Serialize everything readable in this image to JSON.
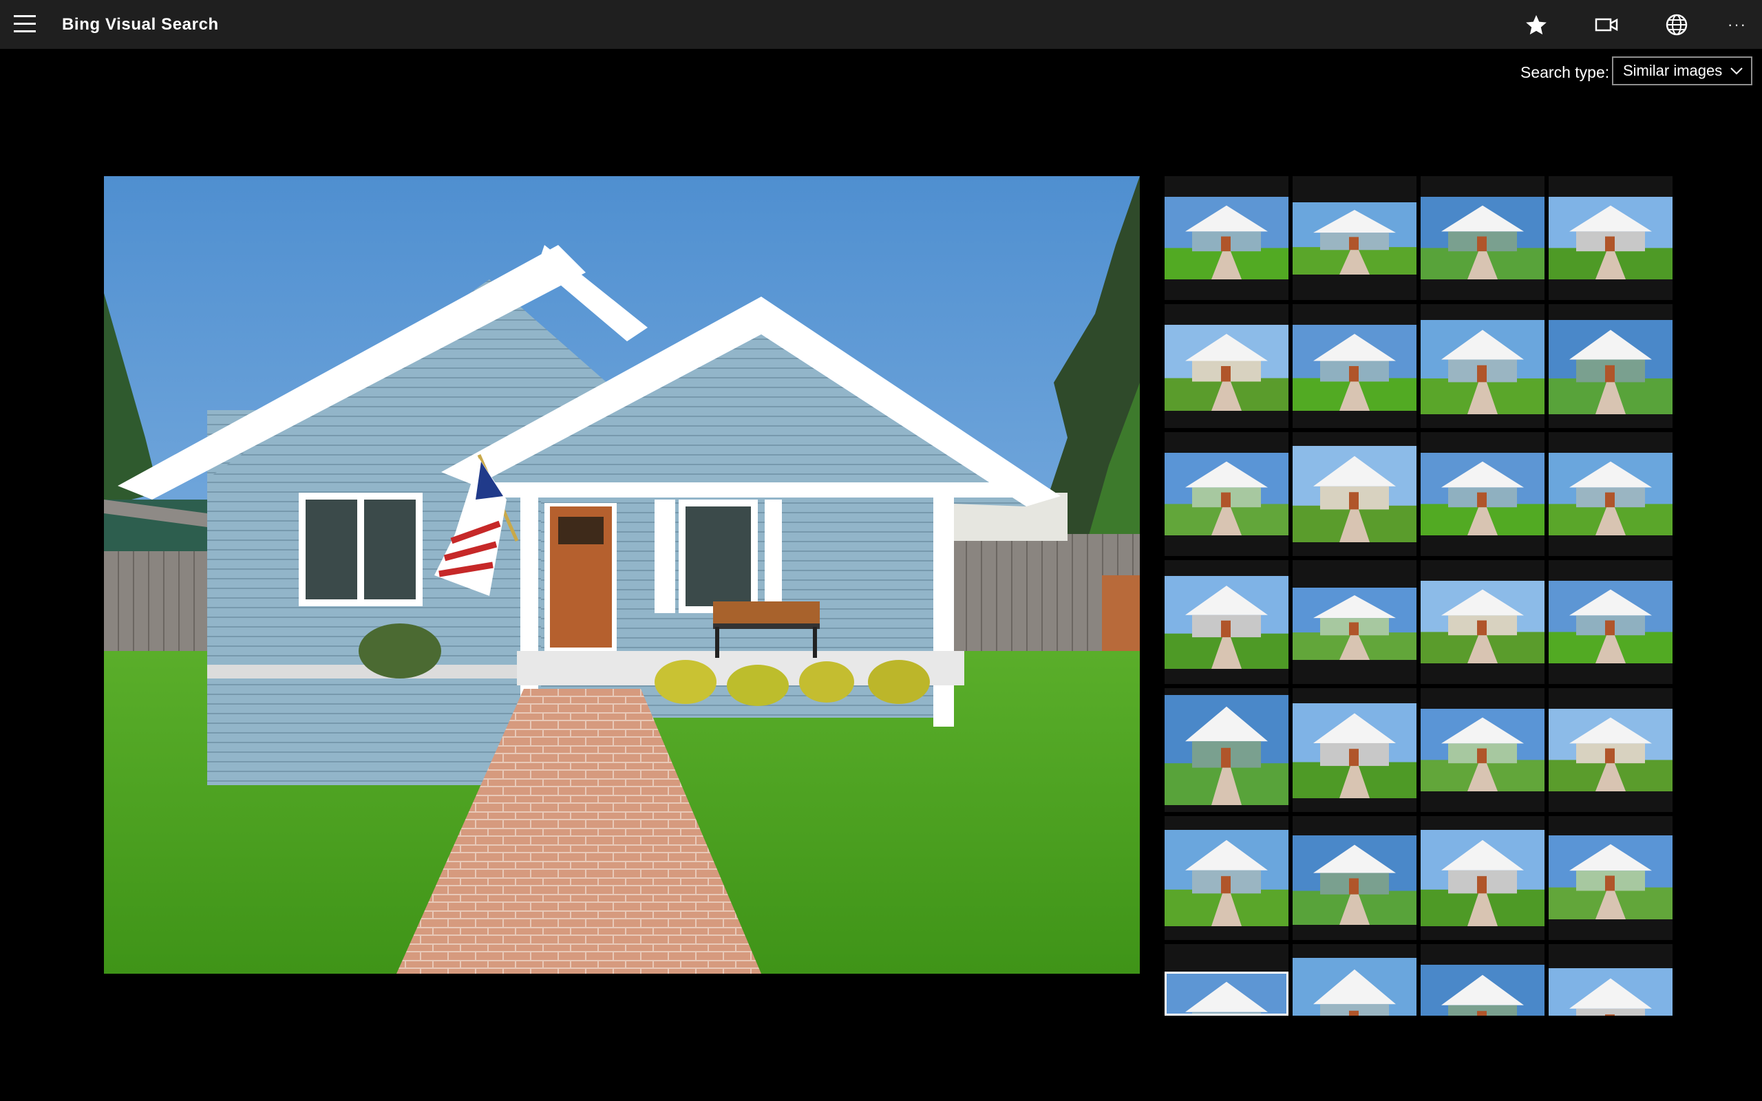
{
  "app": {
    "title": "Bing Visual Search"
  },
  "toolbar": {
    "menu_icon": "hamburger-menu-icon",
    "favorite_icon": "star-icon",
    "video_icon": "video-camera-icon",
    "globe_icon": "globe-icon",
    "more_icon": "more-ellipsis-icon",
    "more_label": "···"
  },
  "search": {
    "type_label": "Search type:",
    "type_value": "Similar images",
    "chevron_icon": "chevron-down-icon"
  },
  "main": {
    "image_alt": "Light blue house with porch, American flag and brick walkway"
  },
  "results": {
    "rows": 7,
    "columns": 4,
    "selected_index": 24,
    "item_count": 28
  },
  "colors": {
    "titlebar_bg": "#1f1f1f",
    "page_bg": "#000000",
    "thumb_bg": "#141414",
    "sky": "#5f9ad6",
    "grass": "#4fa421",
    "siding": "#8fb3c8"
  }
}
